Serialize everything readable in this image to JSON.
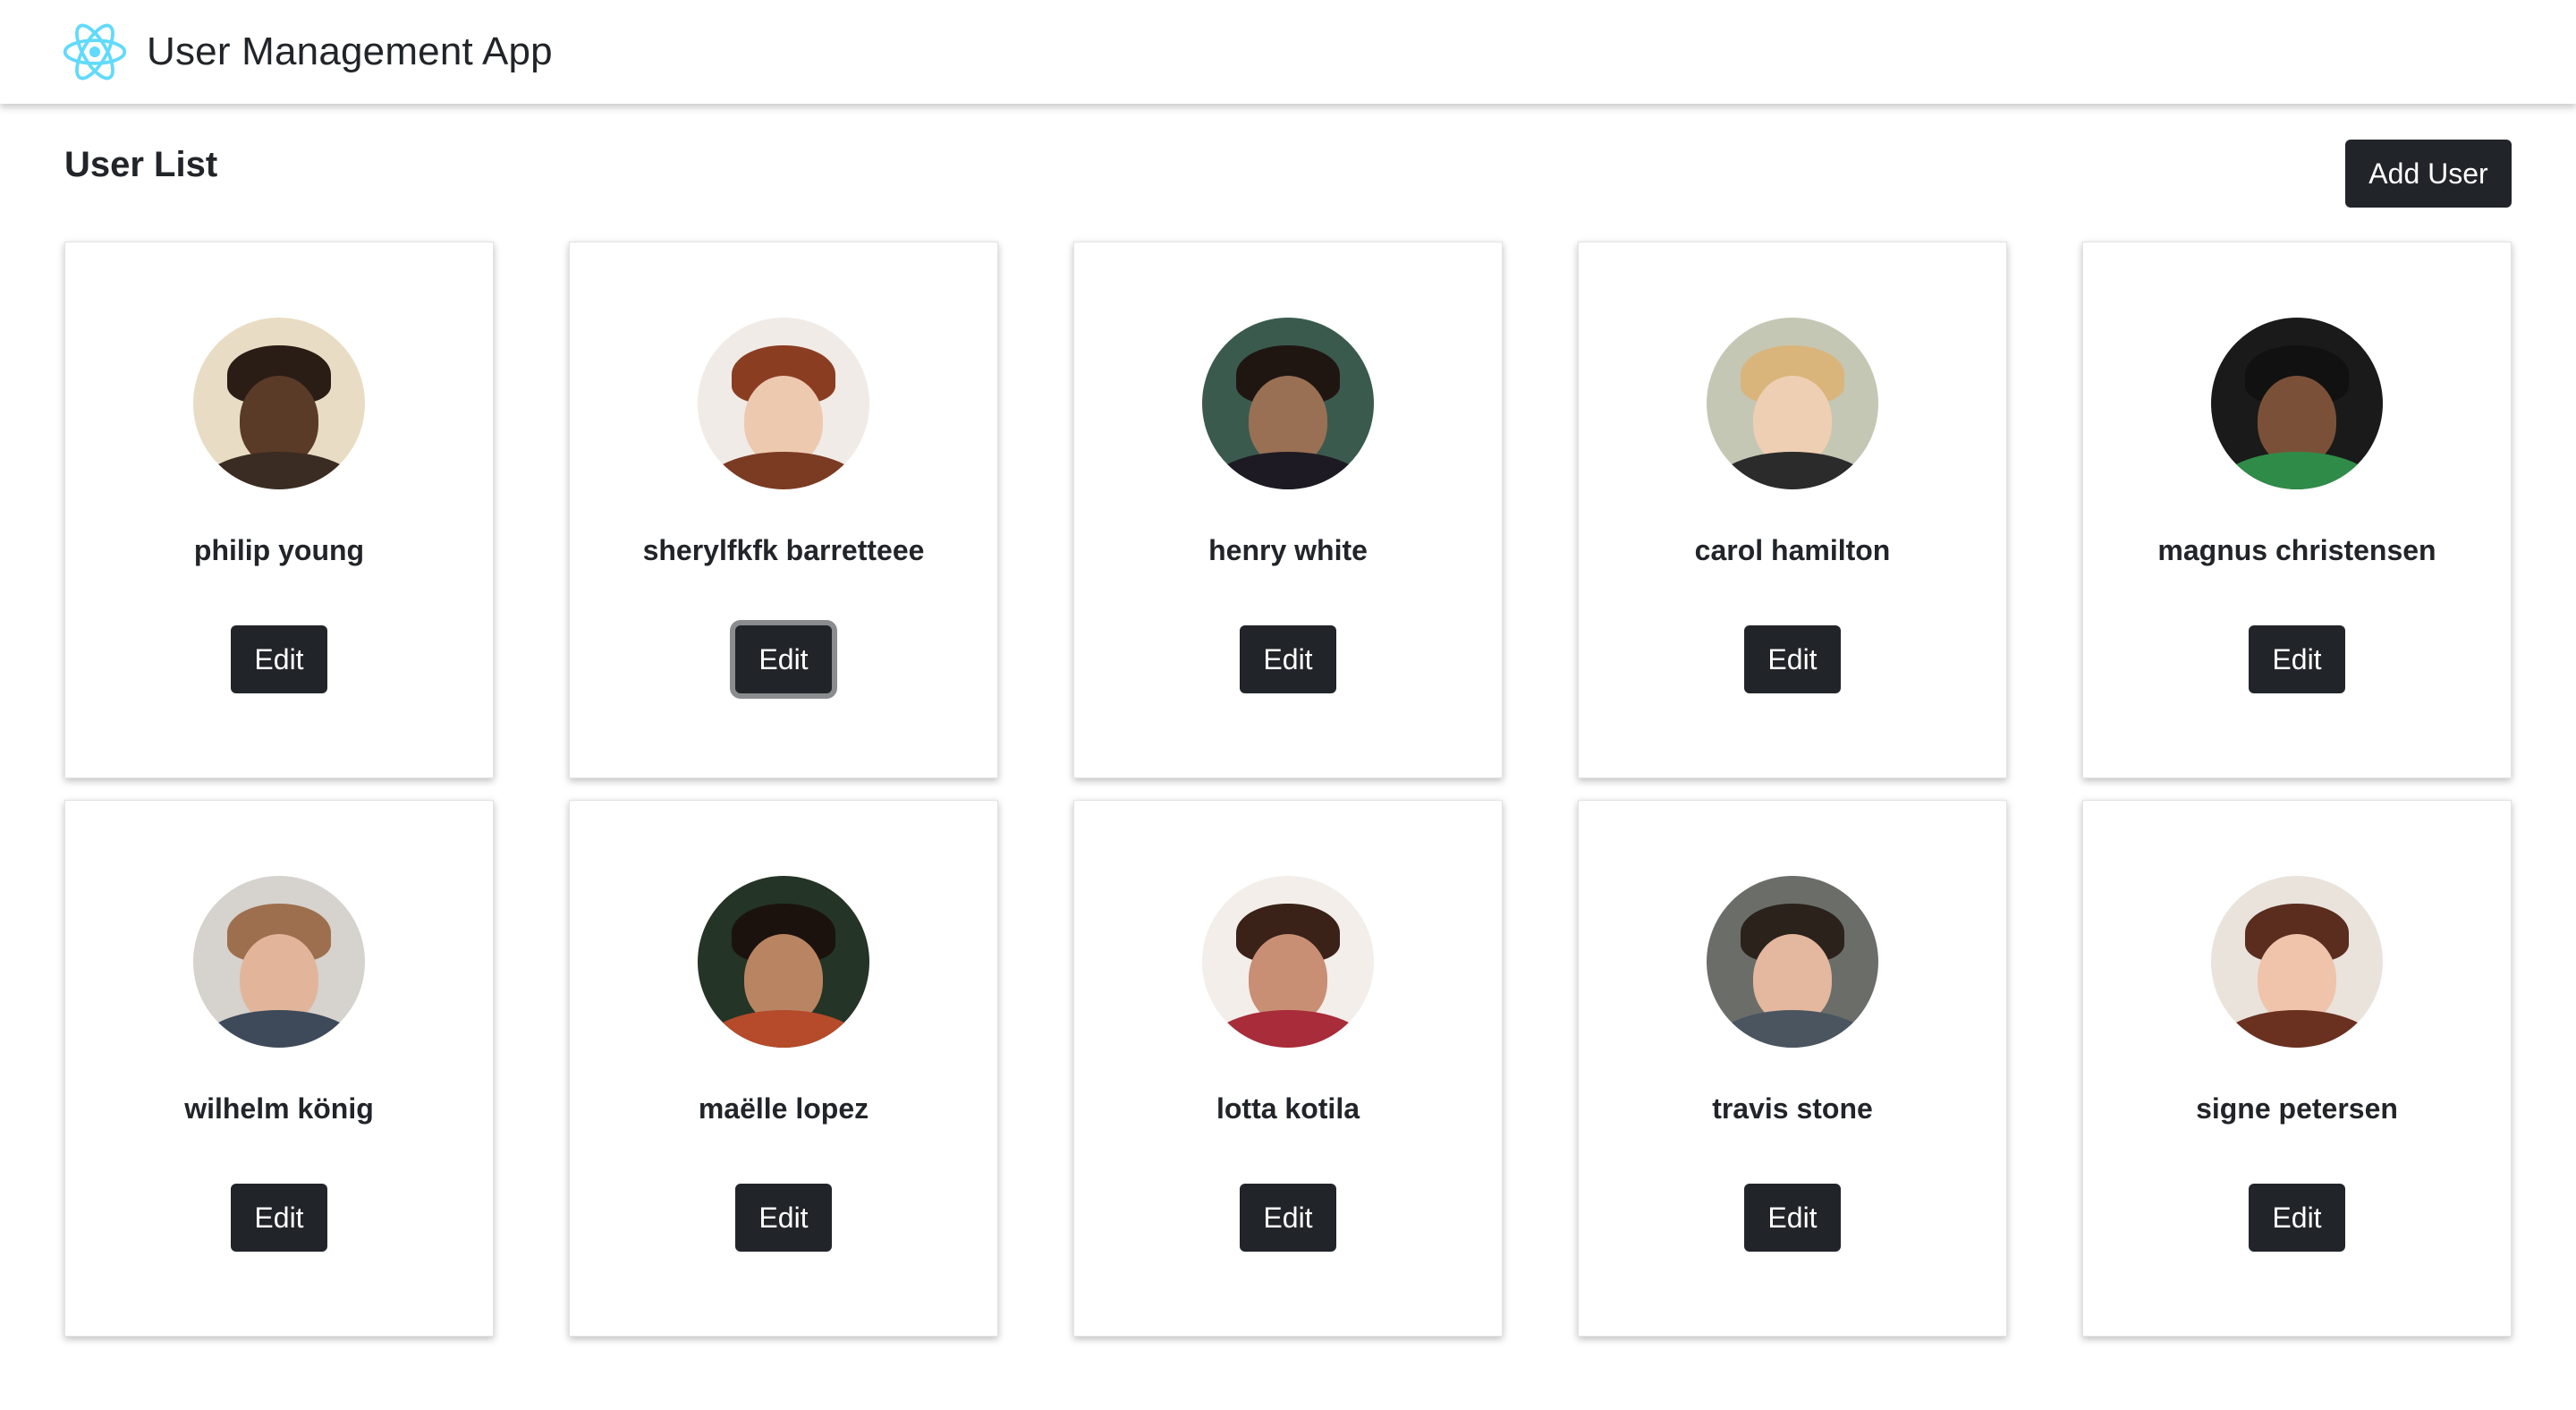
{
  "header": {
    "logo_icon": "react-atom-icon",
    "logo_color": "#61dafb",
    "title": "User Management App"
  },
  "main": {
    "title": "User List",
    "add_button_label": "Add User"
  },
  "colors": {
    "button_bg": "#212529",
    "button_text": "#ffffff",
    "focus_ring": "#8a8d90"
  },
  "users": [
    {
      "name": "philip young",
      "edit_label": "Edit",
      "avatar_icon": "user-photo-icon",
      "bg": "#e8ddc4",
      "skin": "#5a3b28",
      "hair": "#2a1d15",
      "shirt": "#3a2c22"
    },
    {
      "name": "sherylfkfk barretteee",
      "edit_label": "Edit",
      "avatar_icon": "user-photo-icon",
      "bg": "#f0ebe6",
      "skin": "#edc9b0",
      "hair": "#8b3d22",
      "shirt": "#7b3a22"
    },
    {
      "name": "henry white",
      "edit_label": "Edit",
      "avatar_icon": "user-photo-icon",
      "bg": "#3a5a4e",
      "skin": "#9a7054",
      "hair": "#1f1612",
      "shirt": "#1e1a24"
    },
    {
      "name": "carol hamilton",
      "edit_label": "Edit",
      "avatar_icon": "user-photo-icon",
      "bg": "#c4c7b4",
      "skin": "#efcfb3",
      "hair": "#d9b57c",
      "shirt": "#2b2b2b"
    },
    {
      "name": "magnus christensen",
      "edit_label": "Edit",
      "avatar_icon": "user-photo-icon",
      "bg": "#1a1a1a",
      "skin": "#7a5138",
      "hair": "#111111",
      "shirt": "#2f8c48"
    },
    {
      "name": "wilhelm könig",
      "edit_label": "Edit",
      "avatar_icon": "user-photo-icon",
      "bg": "#d6d2cd",
      "skin": "#e2b59b",
      "hair": "#9e6f4e",
      "shirt": "#3e4a5a"
    },
    {
      "name": "maëlle lopez",
      "edit_label": "Edit",
      "avatar_icon": "user-photo-icon",
      "bg": "#243426",
      "skin": "#b98462",
      "hair": "#1b120e",
      "shirt": "#b54b2a"
    },
    {
      "name": "lotta kotila",
      "edit_label": "Edit",
      "avatar_icon": "user-photo-icon",
      "bg": "#f3eee9",
      "skin": "#c98f74",
      "hair": "#3a2218",
      "shirt": "#a82c3a"
    },
    {
      "name": "travis stone",
      "edit_label": "Edit",
      "avatar_icon": "user-photo-icon",
      "bg": "#6b6e68",
      "skin": "#e4b79f",
      "hair": "#2b221c",
      "shirt": "#4a5560"
    },
    {
      "name": "signe petersen",
      "edit_label": "Edit",
      "avatar_icon": "user-photo-icon",
      "bg": "#e9e3dc",
      "skin": "#efc4ab",
      "hair": "#5a2d1e",
      "shirt": "#6a3020"
    }
  ],
  "focused_edit_index": 1
}
